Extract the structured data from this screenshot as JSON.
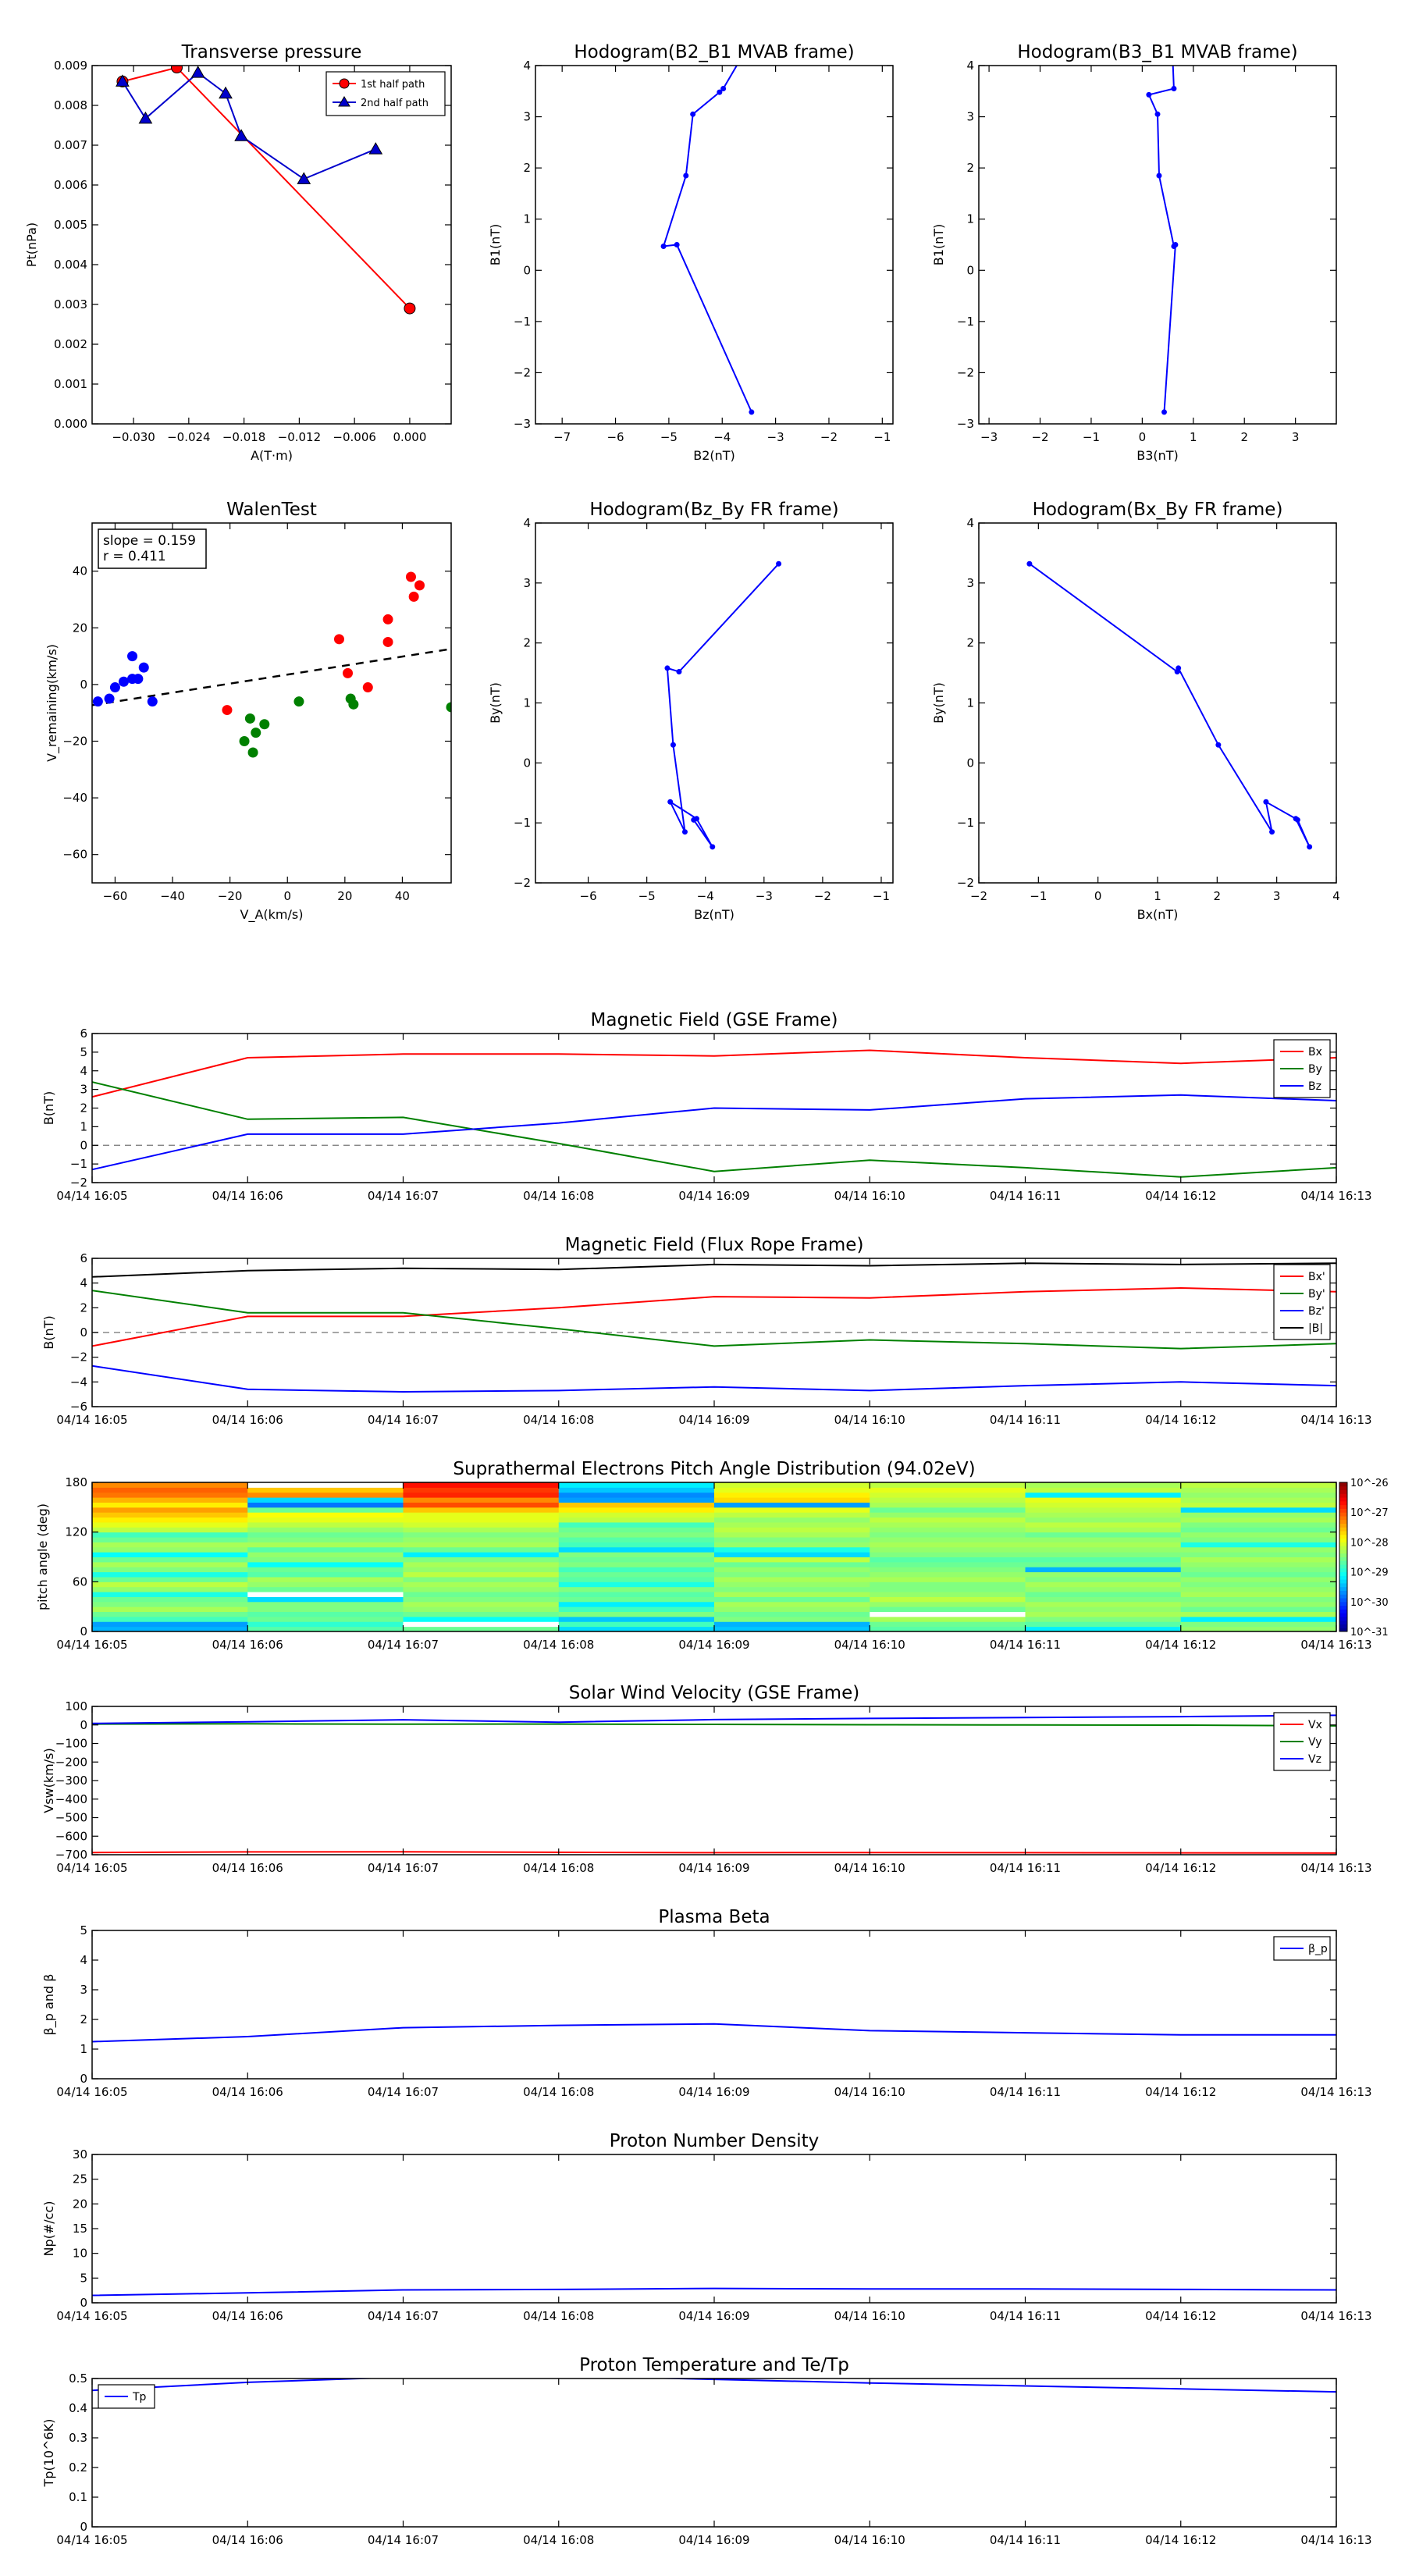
{
  "chart_data": [
    {
      "id": "transverse_pressure",
      "type": "line",
      "title": "Transverse pressure",
      "xlabel": "A(T·m)",
      "ylabel": "Pt(nPa)",
      "xlim": [
        -0.0345,
        0.0045
      ],
      "ylim": [
        0,
        0.009
      ],
      "xticks": [
        -0.03,
        -0.024,
        -0.018,
        -0.012,
        -0.006,
        0.0
      ],
      "xticklabels": [
        "−0.030",
        "−0.024",
        "−0.018",
        "−0.012",
        "−0.006",
        "0.000"
      ],
      "yticks": [
        0,
        0.001,
        0.002,
        0.003,
        0.004,
        0.005,
        0.006,
        0.007,
        0.008,
        0.009
      ],
      "yticklabels": [
        "0.000",
        "0.001",
        "0.002",
        "0.003",
        "0.004",
        "0.005",
        "0.006",
        "0.007",
        "0.008",
        "0.009"
      ],
      "legend": {
        "position": "top-right",
        "boxed": true
      },
      "series": [
        {
          "name": "1st half path",
          "color": "#ff0000",
          "marker": "circle",
          "x": [
            -0.0312,
            -0.0253,
            0.0
          ],
          "y": [
            0.0086,
            0.00895,
            0.0029
          ]
        },
        {
          "name": "2nd half path",
          "color": "#0000cc",
          "marker": "triangle",
          "x": [
            -0.0312,
            -0.0287,
            -0.023,
            -0.02,
            -0.0183,
            -0.0115,
            -0.0037
          ],
          "y": [
            0.0086,
            0.00767,
            0.00882,
            0.0083,
            0.00723,
            0.00615,
            0.0069
          ]
        }
      ]
    },
    {
      "id": "hodo_b2_b1",
      "type": "line",
      "title": "Hodogram(B2_B1 MVAB frame)",
      "xlabel": "B2(nT)",
      "ylabel": "B1(nT)",
      "xlim": [
        -7.5,
        -0.8
      ],
      "ylim": [
        -3,
        4
      ],
      "xticks": [
        -7,
        -6,
        -5,
        -4,
        -3,
        -2,
        -1
      ],
      "yticks": [
        -3,
        -2,
        -1,
        0,
        1,
        2,
        3,
        4
      ],
      "series": [
        {
          "color": "#0000ff",
          "marker": "dot",
          "x": [
            -3.45,
            -4.85,
            -5.1,
            -4.68,
            -4.55,
            -4.05,
            -3.98,
            -3.7
          ],
          "y": [
            -2.77,
            0.5,
            0.47,
            1.85,
            3.05,
            3.48,
            3.55,
            4.05
          ]
        }
      ]
    },
    {
      "id": "hodo_b3_b1",
      "type": "line",
      "title": "Hodogram(B3_B1 MVAB frame)",
      "xlabel": "B3(nT)",
      "ylabel": "B1(nT)",
      "xlim": [
        -3.2,
        3.8
      ],
      "ylim": [
        -3,
        4
      ],
      "xticks": [
        -3,
        -2,
        -1,
        0,
        1,
        2,
        3
      ],
      "yticks": [
        -3,
        -2,
        -1,
        0,
        1,
        2,
        3,
        4
      ],
      "series": [
        {
          "color": "#0000ff",
          "marker": "dot",
          "x": [
            0.43,
            0.65,
            0.62,
            0.33,
            0.3,
            0.13,
            0.62,
            0.6
          ],
          "y": [
            -2.77,
            0.5,
            0.47,
            1.85,
            3.05,
            3.43,
            3.55,
            4.05
          ]
        }
      ]
    },
    {
      "id": "walen_test",
      "type": "scatter",
      "title": "WalenTest",
      "xlabel": "V_A(km/s)",
      "ylabel": "V_remaining(km/s)",
      "xlim": [
        -68,
        57
      ],
      "ylim": [
        -70,
        57
      ],
      "xticks": [
        -60,
        -40,
        -20,
        0,
        20,
        40
      ],
      "yticks": [
        -60,
        -40,
        -20,
        0,
        20,
        40
      ],
      "annotation": [
        "slope = 0.159",
        "r = 0.411"
      ],
      "fit_line": {
        "slope": 0.159,
        "intercept": 3.5,
        "style": "dashed",
        "color": "#000000"
      },
      "series": [
        {
          "color": "#0000ff",
          "x": [
            -66,
            -62,
            -60,
            -57,
            -54,
            -52,
            -50,
            -54,
            -47
          ],
          "y": [
            -6,
            -5,
            -1,
            1,
            2,
            2,
            6,
            10,
            -6
          ]
        },
        {
          "color": "#008000",
          "x": [
            -15,
            -13,
            -11,
            -12,
            -8,
            4,
            22,
            23,
            57
          ],
          "y": [
            -20,
            -12,
            -17,
            -24,
            -14,
            -6,
            -5,
            -7,
            -8
          ]
        },
        {
          "color": "#ff0000",
          "x": [
            -21,
            18,
            21,
            28,
            35,
            35,
            43,
            44,
            46
          ],
          "y": [
            -9,
            16,
            4,
            -1,
            15,
            23,
            38,
            31,
            35
          ]
        }
      ]
    },
    {
      "id": "hodo_bz_by",
      "type": "line",
      "title": "Hodogram(Bz_By FR frame)",
      "xlabel": "Bz(nT)",
      "ylabel": "By(nT)",
      "xlim": [
        -6.9,
        -0.8
      ],
      "ylim": [
        -2,
        4
      ],
      "xticks": [
        -6,
        -5,
        -4,
        -3,
        -2,
        -1
      ],
      "yticks": [
        -2,
        -1,
        0,
        1,
        2,
        3,
        4
      ],
      "series": [
        {
          "color": "#0000ff",
          "marker": "dot",
          "x": [
            -2.75,
            -4.45,
            -4.65,
            -4.55,
            -4.35,
            -4.6,
            -4.15,
            -3.88,
            -4.2
          ],
          "y": [
            3.32,
            1.52,
            1.58,
            0.3,
            -1.15,
            -0.65,
            -0.93,
            -1.4,
            -0.95
          ]
        }
      ]
    },
    {
      "id": "hodo_bx_by",
      "type": "line",
      "title": "Hodogram(Bx_By FR frame)",
      "xlabel": "Bx(nT)",
      "ylabel": "By(nT)",
      "xlim": [
        -2,
        4
      ],
      "ylim": [
        -2,
        4
      ],
      "xticks": [
        -2,
        -1,
        0,
        1,
        2,
        3,
        4
      ],
      "yticks": [
        -2,
        -1,
        0,
        1,
        2,
        3,
        4
      ],
      "series": [
        {
          "color": "#0000ff",
          "marker": "dot",
          "x": [
            -1.15,
            1.33,
            1.35,
            2.02,
            2.92,
            2.82,
            3.32,
            3.55,
            3.35
          ],
          "y": [
            3.32,
            1.52,
            1.58,
            0.3,
            -1.15,
            -0.65,
            -0.93,
            -1.4,
            -0.95
          ]
        }
      ]
    },
    {
      "id": "mag_gse",
      "type": "line",
      "title": "Magnetic Field (GSE Frame)",
      "ylabel": "B(nT)",
      "ylim": [
        -2,
        6
      ],
      "yticks": [
        -2,
        -1,
        0,
        1,
        2,
        3,
        4,
        5,
        6
      ],
      "x": [
        "04/14 16:05",
        "04/14 16:06",
        "04/14 16:07",
        "04/14 16:08",
        "04/14 16:09",
        "04/14 16:10",
        "04/14 16:11",
        "04/14 16:12",
        "04/14 16:13"
      ],
      "zero_line": true,
      "legend": {
        "position": "top-right"
      },
      "series": [
        {
          "name": "Bx",
          "color": "#ff0000",
          "values": [
            2.6,
            4.7,
            4.9,
            4.9,
            4.8,
            5.1,
            4.7,
            4.4,
            4.7
          ]
        },
        {
          "name": "By",
          "color": "#008000",
          "values": [
            3.4,
            1.4,
            1.5,
            0.1,
            -1.4,
            -0.8,
            -1.2,
            -1.7,
            -1.2
          ]
        },
        {
          "name": "Bz",
          "color": "#0000ff",
          "values": [
            -1.3,
            0.6,
            0.6,
            1.2,
            2.0,
            1.9,
            2.5,
            2.7,
            2.4
          ]
        }
      ]
    },
    {
      "id": "mag_fr",
      "type": "line",
      "title": "Magnetic Field (Flux Rope Frame)",
      "ylabel": "B(nT)",
      "ylim": [
        -6,
        6
      ],
      "yticks": [
        -6,
        -4,
        -2,
        0,
        2,
        4,
        6
      ],
      "x": [
        "04/14 16:05",
        "04/14 16:06",
        "04/14 16:07",
        "04/14 16:08",
        "04/14 16:09",
        "04/14 16:10",
        "04/14 16:11",
        "04/14 16:12",
        "04/14 16:13"
      ],
      "zero_line": true,
      "legend": {
        "position": "top-right"
      },
      "series": [
        {
          "name": "Bx'",
          "color": "#ff0000",
          "values": [
            -1.1,
            1.3,
            1.3,
            2.0,
            2.9,
            2.8,
            3.3,
            3.6,
            3.3
          ]
        },
        {
          "name": "By'",
          "color": "#008000",
          "values": [
            3.4,
            1.6,
            1.6,
            0.3,
            -1.1,
            -0.6,
            -0.9,
            -1.3,
            -0.9
          ]
        },
        {
          "name": "Bz'",
          "color": "#0000ff",
          "values": [
            -2.7,
            -4.6,
            -4.8,
            -4.7,
            -4.4,
            -4.7,
            -4.3,
            -4.0,
            -4.3
          ]
        },
        {
          "name": "|B|",
          "color": "#000000",
          "values": [
            4.5,
            5.0,
            5.2,
            5.1,
            5.5,
            5.4,
            5.6,
            5.5,
            5.6
          ]
        }
      ]
    },
    {
      "id": "pad",
      "type": "heatmap",
      "title": "Suprathermal Electrons Pitch Angle Distribution (94.02eV)",
      "ylabel": "pitch angle (deg)",
      "ylim": [
        0,
        180
      ],
      "yticks": [
        0,
        60,
        120,
        180
      ],
      "x": [
        "04/14 16:05",
        "04/14 16:06",
        "04/14 16:07",
        "04/14 16:08",
        "04/14 16:09",
        "04/14 16:10",
        "04/14 16:11",
        "04/14 16:12",
        "04/14 16:13"
      ],
      "colorbar": {
        "scale": "log",
        "ticks": [
          "10^-26",
          "10^-27",
          "10^-28",
          "10^-29",
          "10^-30",
          "10^-31"
        ]
      },
      "note": "columns x rows (rows bottom=0deg to top=180deg, 30 bins); value = log10 intensity, -99 = no data",
      "cells": [
        [
          -29.5,
          -29.6,
          -28.8,
          -28.6,
          -28.3,
          -28.5,
          -28.6,
          -29.0,
          -28.4,
          -28.2,
          -28.6,
          -29.0,
          -28.5,
          -28.3,
          -28.6,
          -29.1,
          -28.4,
          -28.3,
          -28.6,
          -28.8,
          -28.2,
          -28.0,
          -27.8,
          -27.6,
          -27.4,
          -27.8,
          -27.5,
          -27.2,
          -27.1,
          -27.3
        ],
        [
          -28.7,
          -28.9,
          -28.6,
          -28.7,
          -28.5,
          -28.5,
          -29.3,
          -99,
          -28.6,
          -28.4,
          -28.3,
          -28.7,
          -28.6,
          -29.1,
          -28.5,
          -28.4,
          -28.7,
          -28.3,
          -28.5,
          -28.6,
          -28.4,
          -28.2,
          -28.0,
          -27.9,
          -28.6,
          -29.8,
          -29.3,
          -27.3,
          -27.6,
          -99
        ],
        [
          -28.6,
          -99,
          -29.1,
          -28.6,
          -28.4,
          -28.3,
          -28.5,
          -28.6,
          -28.4,
          -28.3,
          -28.5,
          -28.2,
          -28.4,
          -28.3,
          -28.5,
          -29.2,
          -28.6,
          -28.3,
          -28.4,
          -28.5,
          -28.3,
          -28.1,
          -28.0,
          -28.0,
          -27.6,
          -27.0,
          -27.3,
          -26.8,
          -26.9,
          -26.7
        ],
        [
          -29.3,
          -28.8,
          -29.4,
          -28.5,
          -28.8,
          -29.2,
          -28.6,
          -28.7,
          -28.5,
          -29.0,
          -28.7,
          -28.6,
          -28.8,
          -28.5,
          -28.6,
          -28.5,
          -29.3,
          -28.8,
          -28.7,
          -28.5,
          -28.6,
          -28.8,
          -28.2,
          -28.1,
          -27.8,
          -27.6,
          -29.6,
          -29.7,
          -29.4,
          -29.2
        ],
        [
          -29.4,
          -29.5,
          -28.5,
          -28.6,
          -28.4,
          -28.3,
          -28.6,
          -28.3,
          -28.5,
          -28.4,
          -28.3,
          -28.5,
          -28.4,
          -28.6,
          -28.2,
          -29.3,
          -29.0,
          -28.4,
          -28.5,
          -28.3,
          -28.2,
          -28.3,
          -28.4,
          -28.2,
          -28.0,
          -29.6,
          -27.7,
          -27.8,
          -28.0,
          -28.1
        ],
        [
          -28.7,
          -28.6,
          -28.3,
          -99,
          -28.6,
          -28.4,
          -28.2,
          -28.4,
          -28.5,
          -28.5,
          -28.3,
          -28.4,
          -28.5,
          -28.6,
          -28.7,
          -28.5,
          -28.4,
          -28.3,
          -28.4,
          -28.5,
          -28.4,
          -28.3,
          -28.2,
          -28.4,
          -28.6,
          -28.3,
          -28.2,
          -28.1,
          -28.0,
          -28.2
        ],
        [
          -29.2,
          -28.7,
          -28.5,
          -28.3,
          -28.4,
          -28.3,
          -28.5,
          -28.6,
          -28.4,
          -28.3,
          -28.5,
          -28.4,
          -29.5,
          -28.6,
          -28.7,
          -28.5,
          -28.4,
          -28.3,
          -28.4,
          -28.6,
          -28.3,
          -28.2,
          -28.4,
          -28.3,
          -28.2,
          -28.1,
          -28.0,
          -29.2,
          -28.2,
          -28.3
        ],
        [
          -28.4,
          -28.5,
          -29.2,
          -28.3,
          -28.6,
          -28.4,
          -28.5,
          -28.3,
          -28.4,
          -28.5,
          -28.4,
          -28.6,
          -28.5,
          -28.4,
          -28.3,
          -28.5,
          -28.4,
          -29.0,
          -28.5,
          -28.4,
          -28.6,
          -28.5,
          -28.3,
          -28.4,
          -29.3,
          -28.2,
          -28.3,
          -28.4,
          -28.3,
          -28.2
        ]
      ]
    },
    {
      "id": "sw_velocity",
      "type": "line",
      "title": "Solar Wind Velocity (GSE Frame)",
      "ylabel": "Vsw(km/s)",
      "ylim": [
        -700,
        100
      ],
      "yticks": [
        -700,
        -600,
        -500,
        -400,
        -300,
        -200,
        -100,
        0,
        100
      ],
      "yticklabels": [
        "−700",
        "−600",
        "−500",
        "−400",
        "−300",
        "−200",
        "−100",
        "0",
        "100"
      ],
      "x": [
        "04/14 16:05",
        "04/14 16:06",
        "04/14 16:07",
        "04/14 16:08",
        "04/14 16:09",
        "04/14 16:10",
        "04/14 16:11",
        "04/14 16:12",
        "04/14 16:13"
      ],
      "legend": {
        "position": "top-right"
      },
      "series": [
        {
          "name": "Vx",
          "color": "#ff0000",
          "values": [
            -688,
            -685,
            -684,
            -687,
            -689,
            -688,
            -689,
            -690,
            -691
          ]
        },
        {
          "name": "Vy",
          "color": "#008000",
          "values": [
            5,
            6,
            4,
            5,
            3,
            1,
            0,
            -1,
            -5
          ]
        },
        {
          "name": "Vz",
          "color": "#0000ff",
          "values": [
            8,
            17,
            28,
            15,
            29,
            35,
            40,
            45,
            52
          ]
        }
      ]
    },
    {
      "id": "plasma_beta",
      "type": "line",
      "title": "Plasma Beta",
      "ylabel": "β_p and β",
      "ylim": [
        0,
        5
      ],
      "yticks": [
        0,
        1,
        2,
        3,
        4,
        5
      ],
      "x": [
        "04/14 16:05",
        "04/14 16:06",
        "04/14 16:07",
        "04/14 16:08",
        "04/14 16:09",
        "04/14 16:10",
        "04/14 16:11",
        "04/14 16:12",
        "04/14 16:13"
      ],
      "legend": {
        "position": "top-right"
      },
      "series": [
        {
          "name": "β_p",
          "color": "#0000ff",
          "values": [
            1.25,
            1.42,
            1.72,
            1.8,
            1.85,
            1.62,
            1.55,
            1.48,
            1.48
          ]
        }
      ]
    },
    {
      "id": "proton_density",
      "type": "line",
      "title": "Proton Number Density",
      "ylabel": "Np(#/cc)",
      "ylim": [
        0,
        30
      ],
      "yticks": [
        0,
        5,
        10,
        15,
        20,
        25,
        30
      ],
      "x": [
        "04/14 16:05",
        "04/14 16:06",
        "04/14 16:07",
        "04/14 16:08",
        "04/14 16:09",
        "04/14 16:10",
        "04/14 16:11",
        "04/14 16:12",
        "04/14 16:13"
      ],
      "series": [
        {
          "color": "#0000ff",
          "values": [
            1.5,
            2.0,
            2.6,
            2.7,
            2.9,
            2.8,
            2.8,
            2.7,
            2.6
          ]
        }
      ]
    },
    {
      "id": "proton_temp",
      "type": "line",
      "title": "Proton Temperature and Te/Tp",
      "ylabel": "Tp(10^6K)",
      "ylim": [
        0,
        0.5
      ],
      "yticks": [
        0.0,
        0.1,
        0.2,
        0.3,
        0.4,
        0.5
      ],
      "x": [
        "04/14 16:05",
        "04/14 16:06",
        "04/14 16:07",
        "04/14 16:08",
        "04/14 16:09",
        "04/14 16:10",
        "04/14 16:11",
        "04/14 16:12",
        "04/14 16:13"
      ],
      "legend": {
        "position": "top-left"
      },
      "series": [
        {
          "name": "Tp",
          "color": "#0000ff",
          "values": [
            0.46,
            0.487,
            0.505,
            0.51,
            0.497,
            0.485,
            0.475,
            0.465,
            0.455
          ]
        }
      ]
    }
  ]
}
